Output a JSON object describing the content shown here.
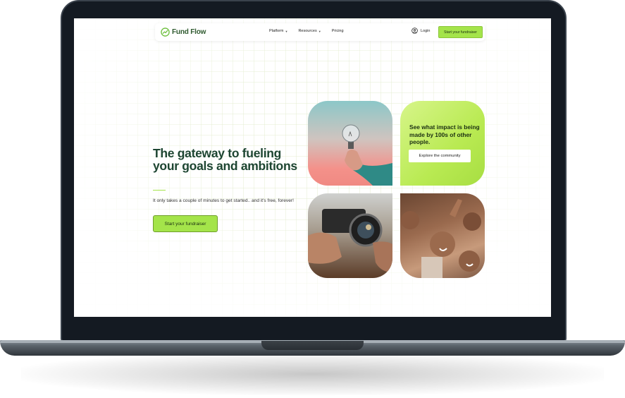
{
  "nav": {
    "logo_text": "Fund Flow",
    "links": [
      {
        "label": "Platform",
        "has_caret": true
      },
      {
        "label": "Resources",
        "has_caret": true
      },
      {
        "label": "Pricing",
        "has_caret": false
      }
    ],
    "login_label": "Login",
    "cta_label": "Start your fundraiser"
  },
  "hero": {
    "headline": "The gateway to fueling your goals and ambitions",
    "subtext": "It only takes a couple of minutes to get started.. and it's free, forever!",
    "cta_label": "Start your fundraiser"
  },
  "impact_card": {
    "text": "See what impact is being made by 100s of other people.",
    "button_label": "Explore the community"
  },
  "icons": {
    "logo": "trend-up-circle-icon",
    "caret": "chevron-down-icon",
    "login": "user-circle-icon"
  },
  "images": [
    {
      "name": "lightbulb-hand-photo"
    },
    {
      "name": "camera-hands-photo"
    },
    {
      "name": "children-group-photo"
    }
  ],
  "colors": {
    "accent": "#a4e44a",
    "headline": "#1d4531",
    "logo": "#2f5a2f"
  }
}
